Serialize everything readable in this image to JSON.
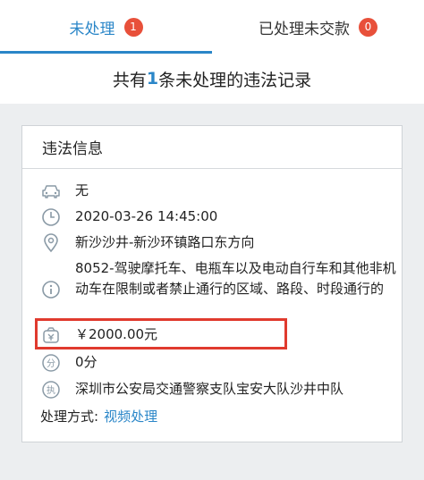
{
  "tabs": [
    {
      "label": "未处理",
      "badge": "1"
    },
    {
      "label": "已处理未交款",
      "badge": "0"
    }
  ],
  "summary": {
    "prefix": "共有",
    "count": "1",
    "suffix": "条未处理的违法记录"
  },
  "card": {
    "title": "违法信息",
    "vehicle": "无",
    "datetime": "2020-03-26 14:45:00",
    "location": "新沙沙井-新沙环镇路口东方向",
    "violation": "8052-驾驶摩托车、电瓶车以及电动自行车和其他非机动车在限制或者禁止通行的区域、路段、时段通行的",
    "fine": "￥2000.00元",
    "points": "0分",
    "authority": "深圳市公安局交通警察支队宝安大队沙井中队",
    "method_label": "处理方式:",
    "method_link": "视频处理"
  },
  "icons": {
    "vehicle": "car-icon",
    "datetime": "clock-icon",
    "location": "map-pin-icon",
    "violation": "info-icon",
    "fine": "money-icon",
    "points": "points-icon",
    "authority": "authority-icon"
  },
  "colors": {
    "accent": "#2a86c8",
    "badge": "#e8503a",
    "highlight": "#e03a2e",
    "icon": "#8a9aa6"
  }
}
